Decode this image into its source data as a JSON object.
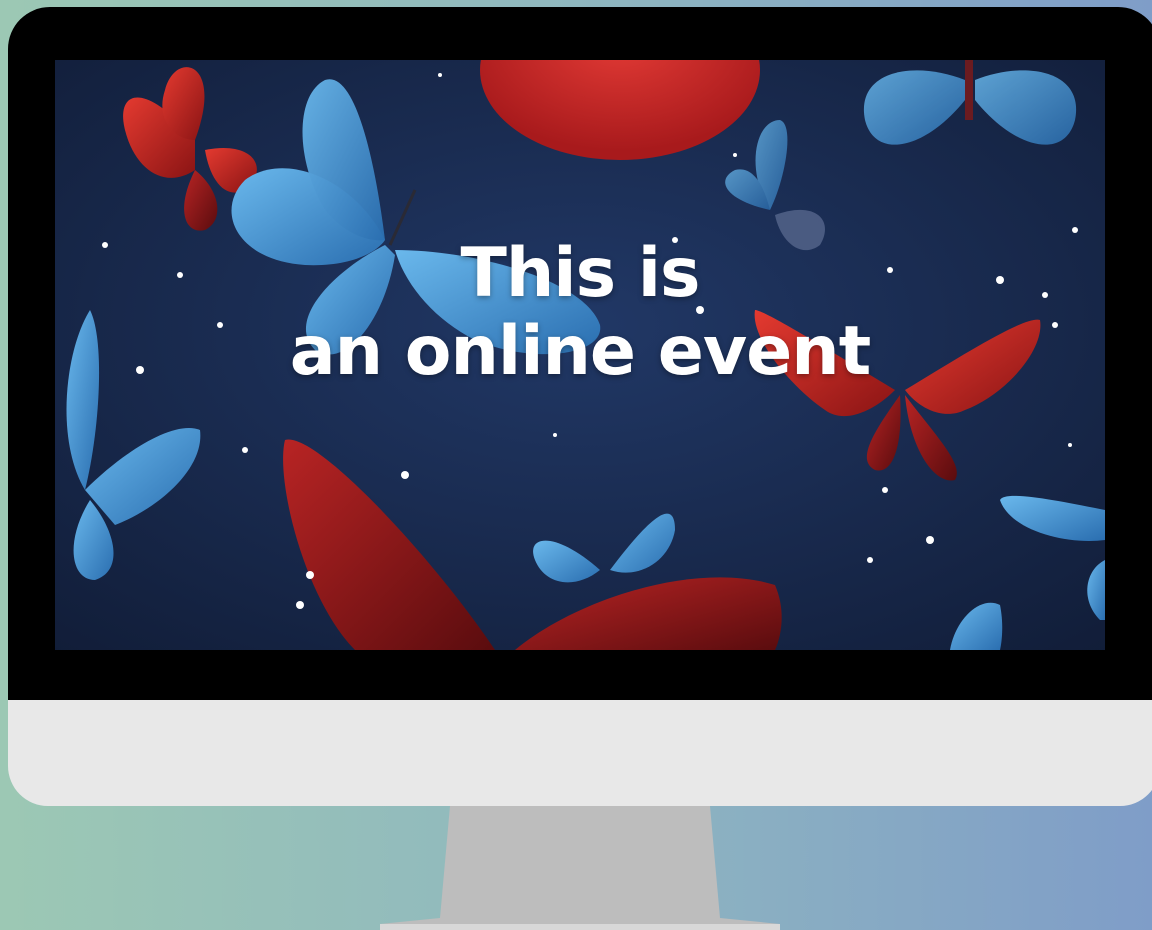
{
  "screen": {
    "headline_line1": "This is",
    "headline_line2": "an online event",
    "background_image": "butterflies-night-sky",
    "colors": {
      "sky": "#1a2a4a",
      "red_butterfly": "#c42020",
      "blue_butterfly": "#3a8fd0",
      "moon": "#d02a28"
    }
  },
  "device": {
    "type": "desktop-monitor",
    "bezel_color": "#000000",
    "chin_color": "#e8e8e8",
    "stand_color": "#bdbdbd"
  },
  "page": {
    "background_gradient": [
      "#9cc8b4",
      "#7f9dc8"
    ]
  }
}
